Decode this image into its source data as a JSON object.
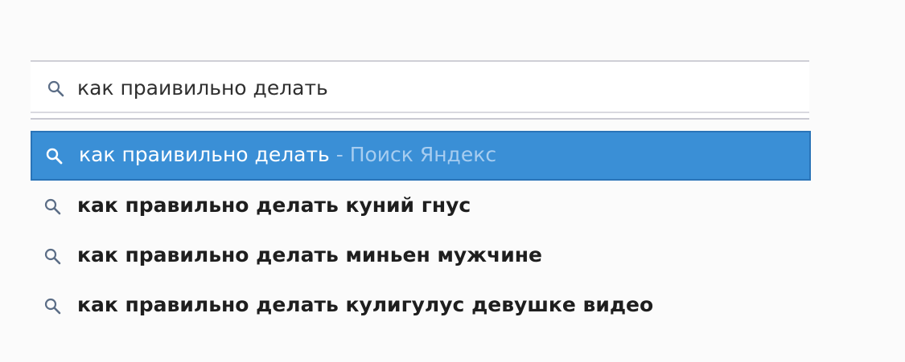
{
  "search": {
    "query": "как праивильно делать",
    "icon": "search-icon"
  },
  "suggestions": [
    {
      "text": "как праивильно делать",
      "suffix": "",
      "engine": " - Поиск Яндекс",
      "highlighted": true
    },
    {
      "text": "как правильно делать",
      "suffix": " куний гнус",
      "engine": ""
    },
    {
      "text": "как правильно делать",
      "suffix": " миньен мужчине",
      "engine": ""
    },
    {
      "text": "как правильно делать",
      "suffix": " кулигулус девушке видео",
      "engine": ""
    }
  ],
  "colors": {
    "highlight": "#3a8fd6",
    "engine_text": "#a7cdf0",
    "text": "#1e1e1e"
  }
}
